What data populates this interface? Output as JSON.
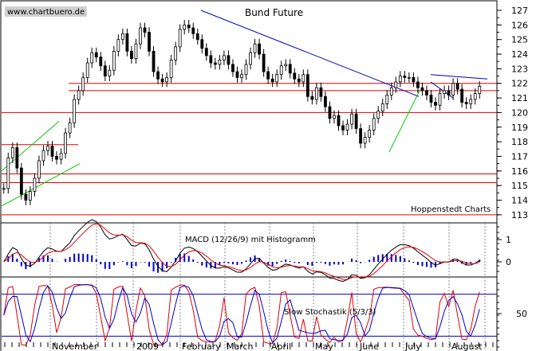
{
  "chart_data": [
    {
      "type": "candlestick",
      "title": "Bund Future",
      "watermark": "www.chartbuero.de",
      "credit": "Hoppenstedt Charts",
      "ylim": [
        112.5,
        127.6
      ],
      "y_ticks": [
        "127",
        "126",
        "125",
        "124",
        "123",
        "122",
        "121",
        "120",
        "119",
        "118",
        "117",
        "116",
        "115",
        "114",
        "113"
      ],
      "x_labels": [
        "November",
        "2009",
        "February",
        "March",
        "April",
        "May",
        "June",
        "July",
        "August"
      ],
      "series": [
        {
          "type": "close",
          "values": [
            114.8,
            116.9,
            117.6,
            116.2,
            114.4,
            114.0,
            114.6,
            115.5,
            116.7,
            117.4,
            117.7,
            117.0,
            116.8,
            117.2,
            118.6,
            119.3,
            120.9,
            121.5,
            122.4,
            123.4,
            124.1,
            123.8,
            123.2,
            122.5,
            122.9,
            124.2,
            125.0,
            125.4,
            124.2,
            123.7,
            124.7,
            125.8,
            125.5,
            124.2,
            122.8,
            122.3,
            122.1,
            122.4,
            123.6,
            124.5,
            125.7,
            126.0,
            125.8,
            125.4,
            125.0,
            124.4,
            123.9,
            123.4,
            123.3,
            123.6,
            123.9,
            123.3,
            122.8,
            122.4,
            122.6,
            123.3,
            124.1,
            124.7,
            124.0,
            122.8,
            122.3,
            122.1,
            122.6,
            123.2,
            123.3,
            122.7,
            122.3,
            122.1,
            122.6,
            121.1,
            120.9,
            121.7,
            121.1,
            120.4,
            119.6,
            119.8,
            119.1,
            118.8,
            119.2,
            119.9,
            118.9,
            117.9,
            118.3,
            118.8,
            119.6,
            120.1,
            120.6,
            121.2,
            121.7,
            122.1,
            122.5,
            122.4,
            122.4,
            122.1,
            121.7,
            121.5,
            121.2,
            120.7,
            120.5,
            121.3,
            121.5,
            121.2,
            122.0,
            121.6,
            120.7,
            120.6,
            120.9,
            121.3,
            121.8
          ]
        }
      ],
      "lines": {
        "support_resistance": [
          122.0,
          121.5,
          120.0,
          117.8,
          115.8,
          115.2,
          113.0
        ],
        "trend_down": "Feb→Jun",
        "trend_up_channel": "Oct→Nov",
        "trend_up_june": "Jun→Jul",
        "flag": "Jul→Aug"
      },
      "colors": {
        "candles": "#000000",
        "hlines": "#e00000",
        "downtrend": "#0000cc",
        "uptrend": "#00cc00",
        "flag": "#0000cc"
      }
    },
    {
      "type": "line",
      "title": "MACD (12/26/9) mit Histogramm",
      "y_ticks": [
        "1",
        "0"
      ],
      "series": [
        {
          "name": "MACD",
          "color": "#000000"
        },
        {
          "name": "Signal",
          "color": "#e00000"
        },
        {
          "name": "Histogramm",
          "color": "#0000cc"
        }
      ]
    },
    {
      "type": "line",
      "title": "Slow Stochastik (5/3/3)",
      "y_ticks": [
        "50"
      ],
      "series": [
        {
          "name": "%K",
          "color": "#e00000"
        },
        {
          "name": "%D",
          "color": "#0000cc"
        }
      ]
    }
  ]
}
